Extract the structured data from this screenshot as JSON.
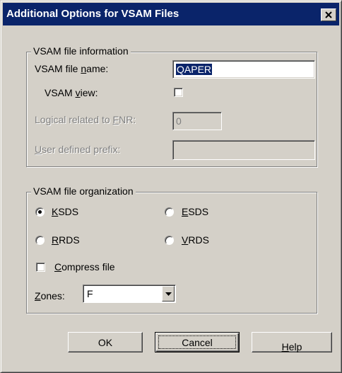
{
  "window": {
    "title": "Additional Options for VSAM Files"
  },
  "file_info": {
    "group_label": "VSAM file information",
    "name_label_pre": "VSAM file ",
    "name_label_u": "n",
    "name_label_post": "ame:",
    "name_value": "QAPER",
    "view_label_pre": "VSAM ",
    "view_label_u": "v",
    "view_label_post": "iew:",
    "view_checked": false,
    "lr_label_pre": "Logical related to ",
    "lr_label_u": "F",
    "lr_label_post": "NR:",
    "lr_value": "0",
    "prefix_label_u": "U",
    "prefix_label_post": "ser defined prefix:",
    "prefix_value": ""
  },
  "organization": {
    "group_label": "VSAM file organization",
    "ksds_u": "K",
    "ksds_post": "SDS",
    "ksds_selected": true,
    "esds_u": "E",
    "esds_post": "SDS",
    "esds_selected": false,
    "rrds_u": "R",
    "rrds_post": "RDS",
    "rrds_selected": false,
    "vrds_u": "V",
    "vrds_post": "RDS",
    "vrds_selected": false,
    "compress_u": "C",
    "compress_post": "ompress file",
    "compress_checked": false,
    "zones_u": "Z",
    "zones_post": "ones:",
    "zones_value": "F"
  },
  "buttons": {
    "ok": "OK",
    "cancel": "Cancel",
    "help_u": "H",
    "help_post": "elp"
  },
  "colors": {
    "titlebar": "#0a246a",
    "face": "#d4d0c8",
    "selection": "#0a246a"
  },
  "icons": {
    "close": "close-icon",
    "dropdown": "chevron-down-icon"
  }
}
